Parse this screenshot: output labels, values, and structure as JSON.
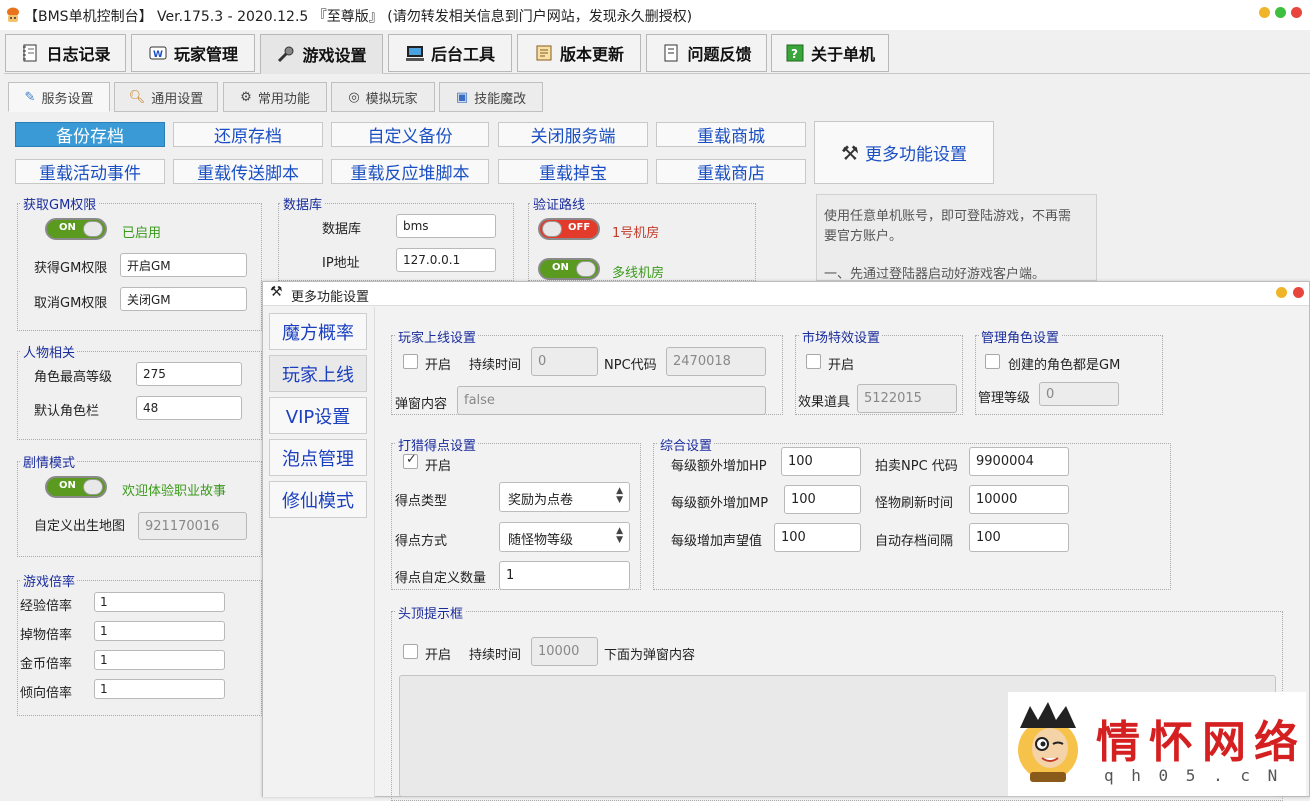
{
  "window": {
    "title": "【BMS单机控制台】 Ver.175.3 - 2020.12.5 『至尊版』 (请勿转发相关信息到门户网站，发现永久删授权)",
    "controls": [
      {
        "name": "minimize",
        "color": "#f0b429"
      },
      {
        "name": "maximize",
        "color": "#3fbf3f"
      },
      {
        "name": "close",
        "color": "#e8463c"
      }
    ]
  },
  "main_tabs": [
    {
      "label": "日志记录",
      "icon": "notebook-icon"
    },
    {
      "label": "玩家管理",
      "icon": "player-card-icon"
    },
    {
      "label": "游戏设置",
      "icon": "wrench-gear-icon",
      "active": true
    },
    {
      "label": "后台工具",
      "icon": "computer-icon"
    },
    {
      "label": "版本更新",
      "icon": "scroll-icon"
    },
    {
      "label": "问题反馈",
      "icon": "feedback-icon"
    },
    {
      "label": "关于单机",
      "icon": "question-icon"
    }
  ],
  "sub_tabs": [
    {
      "label": "服务设置",
      "icon": "pin-icon",
      "active": true
    },
    {
      "label": "通用设置",
      "icon": "magnifier-icon"
    },
    {
      "label": "常用功能",
      "icon": "tools-icon"
    },
    {
      "label": "模拟玩家",
      "icon": "globe-icon"
    },
    {
      "label": "技能魔改",
      "icon": "edit-icon"
    }
  ],
  "actions": {
    "row1": [
      "备份存档",
      "还原存档",
      "自定义备份",
      "关闭服务端",
      "重载商城"
    ],
    "row2": [
      "重载活动事件",
      "重载传送脚本",
      "重载反应堆脚本",
      "重载掉宝",
      "重载商店"
    ],
    "more": "更多功能设置"
  },
  "gm": {
    "title": "获取GM权限",
    "toggle": "ON",
    "status": "已启用",
    "get_label": "获得GM权限",
    "get_value": "开启GM",
    "cancel_label": "取消GM权限",
    "cancel_value": "关闭GM"
  },
  "database": {
    "title": "数据库",
    "db_label": "数据库",
    "db_value": "bms",
    "ip_label": "IP地址",
    "ip_value": "127.0.0.1"
  },
  "route": {
    "title": "验证路线",
    "r1_toggle": "OFF",
    "r1_label": "1号机房",
    "r2_toggle": "ON",
    "r2_label": "多线机房"
  },
  "notice": {
    "line1": "使用任意单机账号，即可登陆游戏，不再需",
    "line2": "要官方账户。",
    "line3": "一、先通过登陆器启动好游戏客户端。"
  },
  "character": {
    "title": "人物相关",
    "max_level_label": "角色最高等级",
    "max_level": "275",
    "slots_label": "默认角色栏",
    "slots": "48"
  },
  "story": {
    "title": "剧情模式",
    "toggle": "ON",
    "status": "欢迎体验职业故事",
    "map_label": "自定义出生地图",
    "map_value": "921170016"
  },
  "rates": {
    "title": "游戏倍率",
    "items": [
      {
        "label": "经验倍率",
        "value": "1"
      },
      {
        "label": "掉物倍率",
        "value": "1"
      },
      {
        "label": "金币倍率",
        "value": "1"
      },
      {
        "label": "倾向倍率",
        "value": "1"
      }
    ]
  },
  "popup": {
    "title": "更多功能设置",
    "sidebar": [
      {
        "label": "魔方概率"
      },
      {
        "label": "玩家上线",
        "active": true
      },
      {
        "label": "VIP设置"
      },
      {
        "label": "泡点管理"
      },
      {
        "label": "修仙模式"
      }
    ],
    "online": {
      "title": "玩家上线设置",
      "enable": "开启",
      "duration_label": "持续时间",
      "duration": "0",
      "npc_label": "NPC代码",
      "npc": "2470018",
      "content_label": "弹窗内容",
      "content": "false"
    },
    "market": {
      "title": "市场特效设置",
      "enable": "开启",
      "item_label": "效果道具",
      "item": "5122015"
    },
    "admin": {
      "title": "管理角色设置",
      "enable": "创建的角色都是GM",
      "level_label": "管理等级",
      "level": "0"
    },
    "hunt": {
      "title": "打猎得点设置",
      "enable": "开启",
      "type_label": "得点类型",
      "type": "奖励为点卷",
      "mode_label": "得点方式",
      "mode": "随怪物等级",
      "custom_label": "得点自定义数量",
      "custom": "1"
    },
    "general": {
      "title": "综合设置",
      "hp_label": "每级额外增加HP",
      "hp": "100",
      "mp_label": "每级额外增加MP",
      "mp": "100",
      "fame_label": "每级增加声望值",
      "fame": "100",
      "npc_label": "拍卖NPC 代码",
      "npc": "9900004",
      "refresh_label": "怪物刷新时间",
      "refresh": "10000",
      "save_label": "自动存档间隔",
      "save": "100"
    },
    "head": {
      "title": "头顶提示框",
      "enable": "开启",
      "duration_label": "持续时间",
      "duration": "10000",
      "hint": "下面为弹窗内容"
    }
  },
  "watermark": {
    "chars": [
      "情",
      "怀",
      "网",
      "络"
    ],
    "url": "q h 0 5 . c N"
  }
}
